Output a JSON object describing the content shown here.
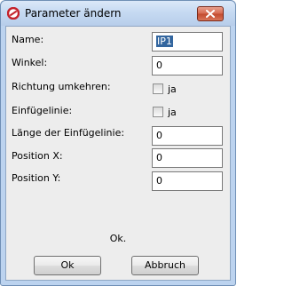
{
  "window": {
    "title": "Parameter ändern"
  },
  "fields": {
    "name_label": "Name:",
    "name_value": "IP1",
    "winkel_label": "Winkel:",
    "winkel_value": "0",
    "richtung_label": "Richtung umkehren:",
    "richtung_check_label": "ja",
    "einfuegelinie_label": "Einfügelinie:",
    "einfuegelinie_check_label": "ja",
    "laenge_label": "Länge der Einfügelinie:",
    "laenge_value": "0",
    "posx_label": "Position X:",
    "posx_value": "0",
    "posy_label": "Position Y:",
    "posy_value": "0"
  },
  "status": {
    "text": "Ok."
  },
  "buttons": {
    "ok_label": "Ok",
    "cancel_label": "Abbruch"
  },
  "colors": {
    "frame": "#bcd3ef",
    "client": "#ededed",
    "selection": "#33669f",
    "close": "#c24a2e"
  },
  "icons": {
    "app": "red-ring-app-icon",
    "close": "close-x-icon"
  }
}
